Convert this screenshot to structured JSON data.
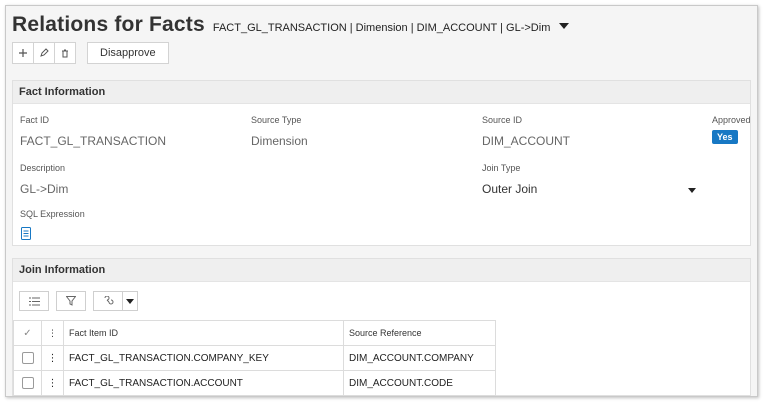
{
  "header": {
    "title": "Relations for Facts",
    "breadcrumb": "FACT_GL_TRANSACTION | Dimension | DIM_ACCOUNT | GL->Dim"
  },
  "toolbar": {
    "add_icon": "plus-icon",
    "edit_icon": "pencil-icon",
    "delete_icon": "trash-icon",
    "disapprove_label": "Disapprove"
  },
  "fact_info": {
    "title": "Fact Information",
    "fact_id": {
      "label": "Fact ID",
      "value": "FACT_GL_TRANSACTION"
    },
    "source_type": {
      "label": "Source Type",
      "value": "Dimension"
    },
    "source_id": {
      "label": "Source ID",
      "value": "DIM_ACCOUNT"
    },
    "approved": {
      "label": "Approved",
      "value": "Yes"
    },
    "description": {
      "label": "Description",
      "value": "GL->Dim"
    },
    "join_type": {
      "label": "Join Type",
      "value": "Outer Join"
    },
    "sql_expression": {
      "label": "SQL Expression",
      "icon": "document-icon"
    }
  },
  "join_info": {
    "title": "Join Information",
    "columns": [
      "Fact Item ID",
      "Source Reference"
    ],
    "check_header": "✓",
    "menu_header": "⋮",
    "row_menu": "⋮",
    "rows": [
      {
        "fact_item_id": "FACT_GL_TRANSACTION.COMPANY_KEY",
        "source_reference": "DIM_ACCOUNT.COMPANY"
      },
      {
        "fact_item_id": "FACT_GL_TRANSACTION.ACCOUNT",
        "source_reference": "DIM_ACCOUNT.CODE"
      }
    ]
  },
  "colors": {
    "accent": "#1778c4",
    "panel_header": "#efefef"
  }
}
